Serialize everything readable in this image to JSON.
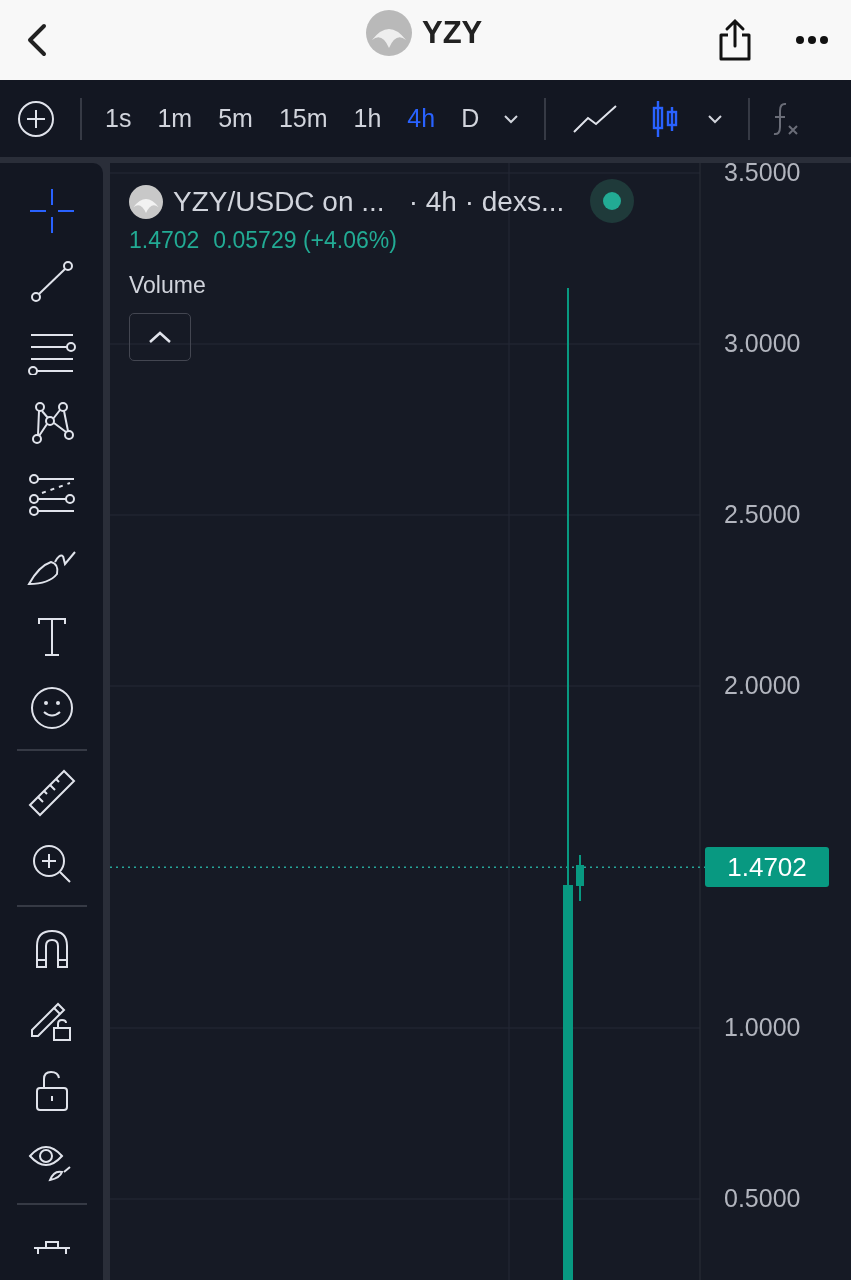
{
  "header": {
    "title": "YZY"
  },
  "timeframes": [
    {
      "label": "1s",
      "selected": false
    },
    {
      "label": "1m",
      "selected": false
    },
    {
      "label": "5m",
      "selected": false
    },
    {
      "label": "15m",
      "selected": false
    },
    {
      "label": "1h",
      "selected": false
    },
    {
      "label": "4h",
      "selected": true
    },
    {
      "label": "D",
      "selected": false
    }
  ],
  "chart_types": [
    {
      "kind": "line",
      "selected": false
    },
    {
      "kind": "candles",
      "selected": true
    }
  ],
  "tools": [
    {
      "kind": "crosshair",
      "selected": true
    },
    {
      "kind": "trendline",
      "selected": false
    },
    {
      "kind": "fib",
      "selected": false
    },
    {
      "kind": "pattern",
      "selected": false
    },
    {
      "kind": "forecast",
      "selected": false
    },
    {
      "kind": "brush",
      "selected": false
    },
    {
      "kind": "text",
      "selected": false
    },
    {
      "kind": "emoji",
      "selected": false
    },
    {
      "kind": "separator"
    },
    {
      "kind": "ruler",
      "selected": false
    },
    {
      "kind": "zoom",
      "selected": false
    },
    {
      "kind": "separator"
    },
    {
      "kind": "magnet",
      "selected": false
    },
    {
      "kind": "lockdraw",
      "selected": false
    },
    {
      "kind": "lock",
      "selected": false
    },
    {
      "kind": "eye",
      "selected": false
    },
    {
      "kind": "separator"
    },
    {
      "kind": "trash",
      "selected": false
    }
  ],
  "legend": {
    "symbol": "YZY/USDC on ...",
    "interval": "· 4h · dexs...",
    "price": "1.4702",
    "change": "0.05729 (+4.06%)",
    "indicator": "Volume"
  },
  "price_scale": [
    "3.5000",
    "3.0000",
    "2.5000",
    "2.0000",
    "1.0000",
    "0.5000"
  ],
  "last_price": "1.4702"
}
